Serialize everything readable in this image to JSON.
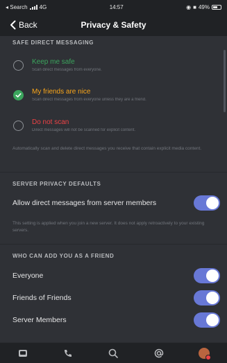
{
  "status_bar": {
    "carrier": "◂ Search",
    "network": "4G",
    "time": "14:57",
    "battery_pct": "49%"
  },
  "nav": {
    "back_label": "Back",
    "title": "Privacy & Safety"
  },
  "safe_dm": {
    "header": "SAFE DIRECT MESSAGING",
    "options": [
      {
        "title": "Keep me safe",
        "desc": "Scan direct messages from everyone.",
        "color": "#3ba55d",
        "checked": false
      },
      {
        "title": "My friends are nice",
        "desc": "Scan direct messages from everyone unless they are a friend.",
        "color": "#faa61a",
        "checked": true
      },
      {
        "title": "Do not scan",
        "desc": "Direct messages will not be scanned for explicit content.",
        "color": "#ed4245",
        "checked": false
      }
    ],
    "note": "Automatically scan and delete direct messages you receive that contain explicit media content."
  },
  "server_privacy": {
    "header": "SERVER PRIVACY DEFAULTS",
    "toggle_label": "Allow direct messages from server members",
    "toggle_on": true,
    "note": "This setting is applied when you join a new server. It does not apply retroactively to your existing servers."
  },
  "friend_requests": {
    "header": "WHO CAN ADD YOU AS A FRIEND",
    "items": [
      {
        "label": "Everyone",
        "on": true
      },
      {
        "label": "Friends of Friends",
        "on": true
      },
      {
        "label": "Server Members",
        "on": true
      }
    ]
  },
  "tab_bar": {
    "icons": [
      "home-icon",
      "friends-icon",
      "search-icon",
      "mentions-icon",
      "profile-avatar"
    ]
  },
  "colors": {
    "accent": "#6878d6",
    "background": "#2f3136",
    "bar": "#202225"
  }
}
